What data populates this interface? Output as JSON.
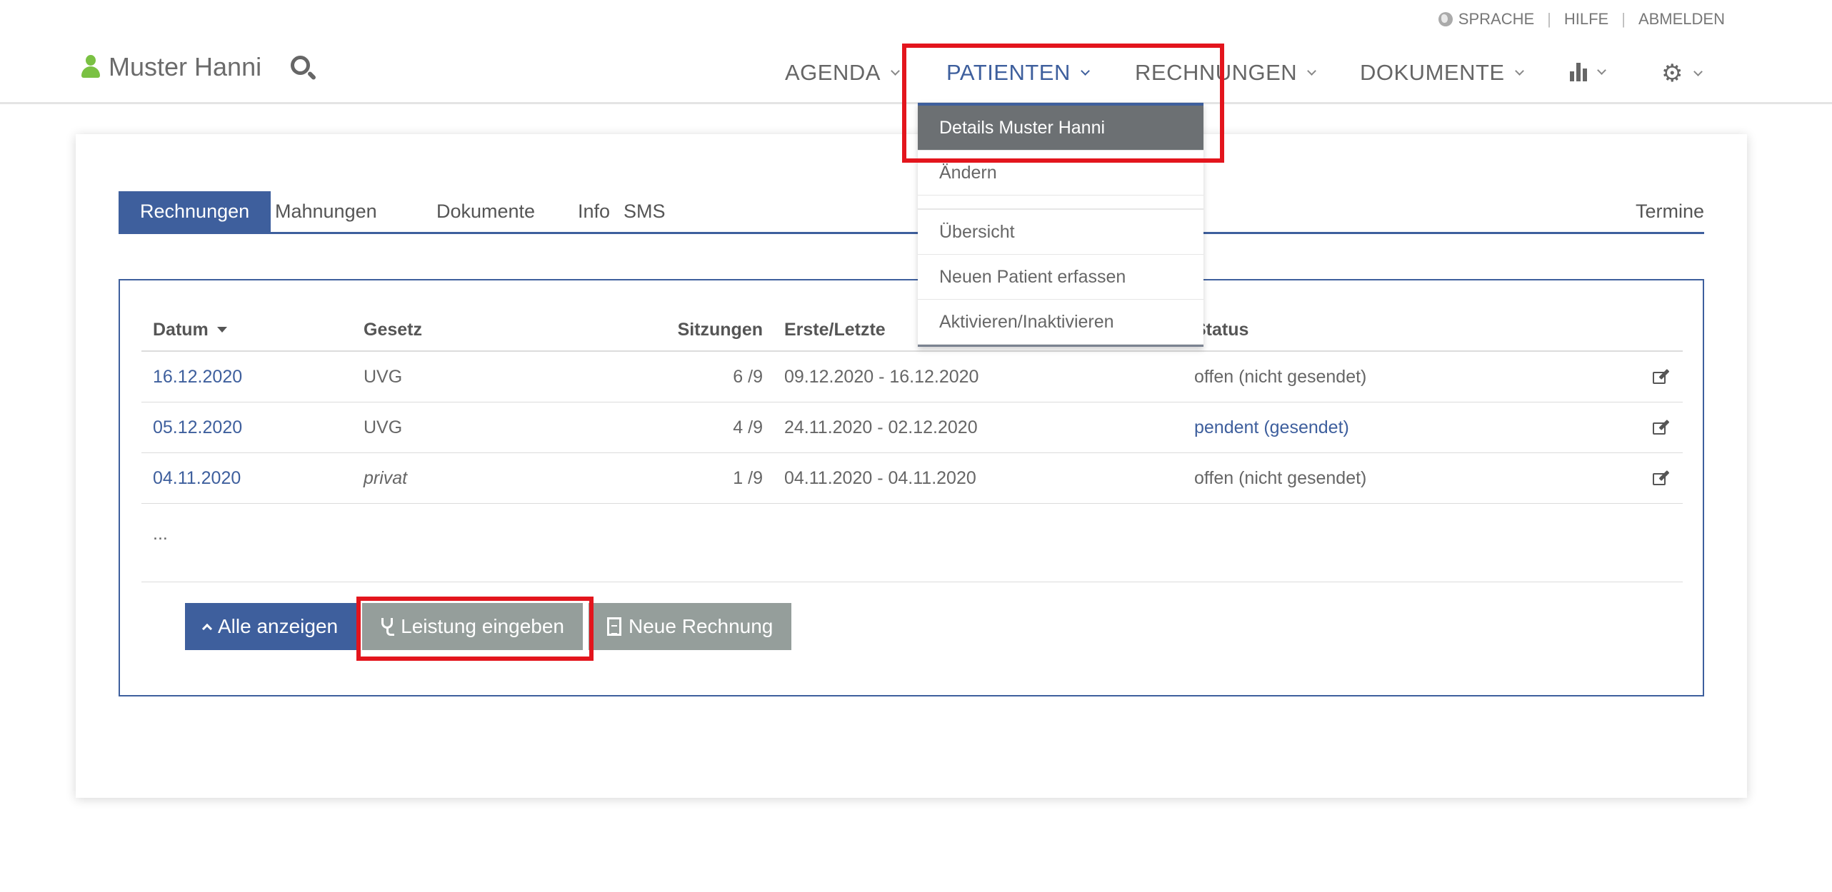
{
  "utility": {
    "language": "SPRACHE",
    "help": "HILFE",
    "logout": "ABMELDEN"
  },
  "header": {
    "user_name": "Muster Hanni",
    "nav": [
      {
        "label": "AGENDA"
      },
      {
        "label": "PATIENTEN",
        "active": true
      },
      {
        "label": "RECHNUNGEN"
      },
      {
        "label": "DOKUMENTE"
      }
    ],
    "icons": [
      "user-icon",
      "search-icon",
      "bar-chart-icon",
      "gear-icon"
    ]
  },
  "dropdown": {
    "items": [
      {
        "label": "Details Muster Hanni",
        "active": true
      },
      {
        "label": "Ändern"
      },
      {
        "label": "Übersicht"
      },
      {
        "label": "Neuen Patient erfassen"
      },
      {
        "label": "Aktivieren/Inaktivieren"
      }
    ]
  },
  "tabs": {
    "items": [
      "Rechnungen",
      "Mahnungen",
      "Dokumente",
      "Info",
      "SMS"
    ],
    "right": "Termine",
    "active": "Rechnungen"
  },
  "table": {
    "headers": {
      "date": "Datum",
      "law": "Gesetz",
      "sessions": "Sitzungen",
      "range": "Erste/Letzte",
      "status": "Status"
    },
    "rows": [
      {
        "date": "16.12.2020",
        "law": "UVG",
        "sessions": "6 /9",
        "range": "09.12.2020 - 16.12.2020",
        "status": "offen (nicht gesendet)"
      },
      {
        "date": "05.12.2020",
        "law": "UVG",
        "sessions": "4 /9",
        "range": "24.11.2020 - 02.12.2020",
        "status": "pendent (gesendet)"
      },
      {
        "date": "04.11.2020",
        "law": "privat",
        "sessions": "1 /9",
        "range": "04.11.2020 - 04.11.2020",
        "status": "offen (nicht gesendet)"
      }
    ],
    "more": "..."
  },
  "buttons": {
    "show_all": "Alle anzeigen",
    "enter_service": "Leistung eingeben",
    "new_invoice": "Neue Rechnung"
  },
  "colors": {
    "primary": "#3e5f9d",
    "secondary": "#959e9b",
    "highlight": "#e3151d",
    "user_green": "#7ac143"
  }
}
